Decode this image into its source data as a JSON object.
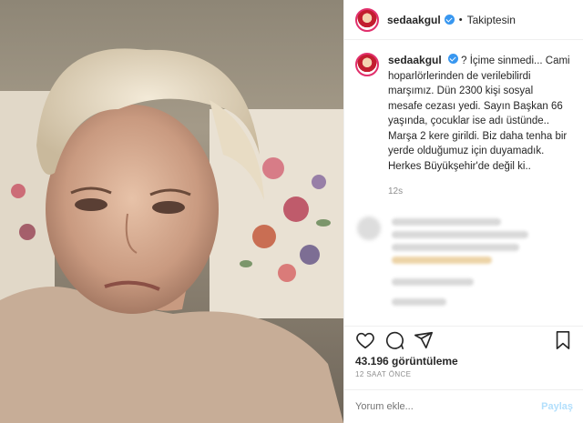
{
  "header": {
    "username": "sedaakgul",
    "follow_status": "Takiptesin"
  },
  "caption": {
    "username": "sedaakgul",
    "text": "? İçime sinmedi... Cami hoparlörlerinden de verilebilirdi marşımız. Dün 2300 kişi sosyal mesafe cezası yedi. Sayın Başkan 66 yaşında, çocuklar ise adı üstünde.. Marşa 2 kere girildi. Biz daha tenha bir yerde olduğumuz için duyamadık. Herkes Büyükşehir'de değil ki..",
    "time": "12s"
  },
  "stats": {
    "views": "43.196 görüntüleme",
    "posted_ago": "12 SAAT ÖNCE"
  },
  "comment": {
    "placeholder": "Yorum ekle...",
    "post_label": "Paylaş"
  },
  "icons": [
    "heart-icon",
    "comment-icon",
    "share-icon",
    "bookmark-icon",
    "verified-icon"
  ],
  "colors": {
    "verified": "#3897f0",
    "post_button": "#b2dffc"
  }
}
